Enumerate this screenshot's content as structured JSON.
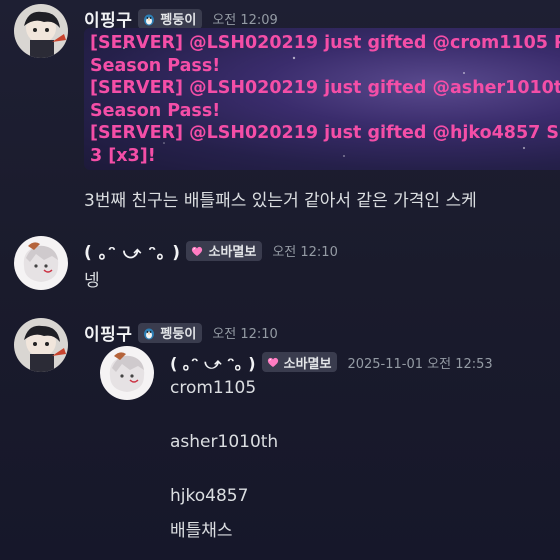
{
  "messages": [
    {
      "username": "이핑구",
      "role_tag": "펭둥이",
      "role_icon": "penguin-icon",
      "time": "오전 12:09",
      "embed_lines": [
        "[SERVER] @LSH020219 just gifted @crom1105 P",
        "Season Pass!",
        "[SERVER] @LSH020219 just gifted @asher1010th",
        "Season Pass!",
        "[SERVER] @LSH020219 just gifted @hjko4857 S",
        "3 [x3]!"
      ],
      "text": "3번째 친구는 배틀패스 있는거 같아서 같은 가격인 스케"
    },
    {
      "username": "( ｡ᵔ ⤻ ᵔ｡ )",
      "role_tag": "소바멸보",
      "role_icon": "heart-icon",
      "time": "오전 12:10",
      "text": "넹"
    },
    {
      "username": "이핑구",
      "role_tag": "펭둥이",
      "role_icon": "penguin-icon",
      "time": "오전 12:10",
      "forwarded": {
        "username": "( ｡ᵔ ⤻ ᵔ｡ )",
        "role_tag": "소바멸보",
        "role_icon": "heart-icon",
        "time": "2025-11-01 오전 12:53",
        "lines": [
          "crom1105",
          "",
          "asher1010th",
          "",
          "hjko4857",
          "배틀채스"
        ]
      }
    }
  ],
  "colors": {
    "background": "#1c1d2f",
    "embed_text": "#f44ea7",
    "username": "#f2f3f5",
    "timestamp": "#949ba4",
    "tag_bg": "#3a3c4e"
  }
}
